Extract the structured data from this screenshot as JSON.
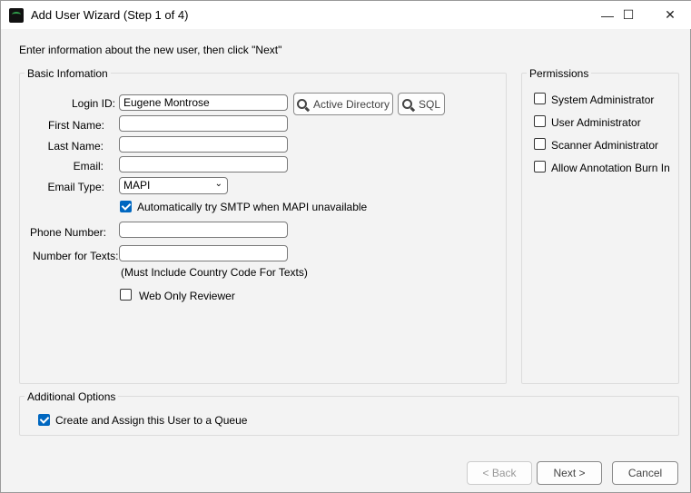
{
  "window": {
    "title": "Add User Wizard (Step 1 of 4)",
    "minimize": "—",
    "maximize": "☐",
    "close": "✕"
  },
  "instructions": "Enter information about the new user, then click \"Next\"",
  "basic": {
    "title": "Basic Infomation",
    "login_label": "Login ID:",
    "login_value": "Eugene Montrose",
    "ad_button": "Active Directory",
    "sql_button": "SQL",
    "first_label": "First Name:",
    "first_value": "",
    "last_label": "Last Name:",
    "last_value": "",
    "email_label": "Email:",
    "email_value": "",
    "email_type_label": "Email Type:",
    "email_type_value": "MAPI",
    "smtp_label": "Automatically try SMTP when MAPI unavailable",
    "smtp_checked": true,
    "phone_label": "Phone Number:",
    "phone_value": "",
    "texts_label": "Number for Texts:",
    "texts_value": "",
    "texts_hint": "(Must Include Country Code For Texts)",
    "web_label": "Web Only Reviewer",
    "web_checked": false
  },
  "permissions": {
    "title": "Permissions",
    "items": [
      {
        "label": "System Administrator",
        "checked": false
      },
      {
        "label": "User Administrator",
        "checked": false
      },
      {
        "label": "Scanner Administrator",
        "checked": false
      },
      {
        "label": "Allow Annotation Burn In",
        "checked": false
      }
    ]
  },
  "additional": {
    "title": "Additional Options",
    "queue_label": "Create and Assign this User to a Queue",
    "queue_checked": true
  },
  "footer": {
    "back": "< Back",
    "next": "Next >",
    "cancel": "Cancel"
  },
  "colors": {
    "accent": "#0067c0"
  }
}
